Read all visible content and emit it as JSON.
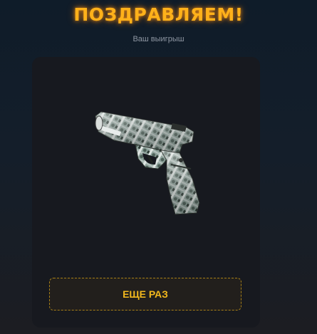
{
  "header": {
    "title": "ПОЗДРАВЛЯЕМ!",
    "subtitle": "Ваш выигрыш"
  },
  "prize": {
    "icon": "pistol-icon"
  },
  "actions": {
    "again_label": "ЕЩЕ РАЗ"
  },
  "colors": {
    "accent": "#ffb11a",
    "button_text": "#f2b81d",
    "card_bg": "#17191f"
  }
}
